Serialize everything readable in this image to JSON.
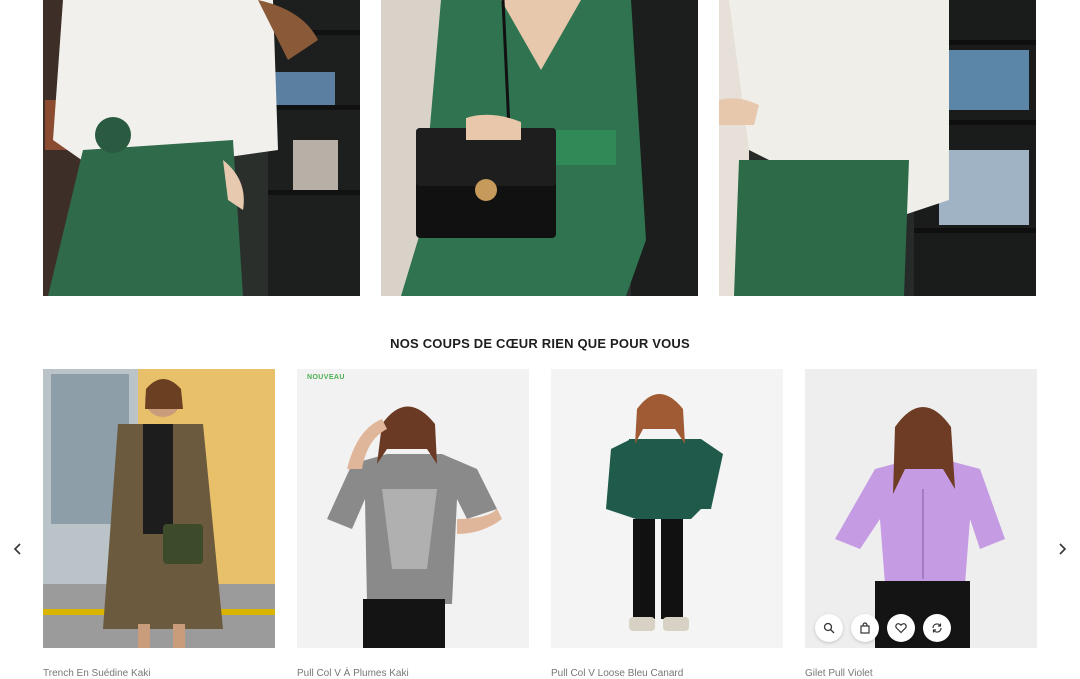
{
  "section": {
    "title": "NOS COUPS DE CŒUR RIEN QUE POUR VOUS"
  },
  "lookbook": [
    {
      "icon": "white-sweater-green-skirt-photo"
    },
    {
      "icon": "green-dress-black-bag-photo"
    },
    {
      "icon": "white-sweater-floral-skirt-photo"
    }
  ],
  "products": [
    {
      "name": "Trench En Suédine Kaki",
      "badge": "",
      "image": "khaki-trench-photo"
    },
    {
      "name": "Pull Col V À Plumes Kaki",
      "badge": "NOUVEAU",
      "image": "grey-tshirt-photo"
    },
    {
      "name": "Pull Col V Loose Bleu Canard",
      "badge": "",
      "image": "teal-sweater-photo"
    },
    {
      "name": "Gilet Pull Violet",
      "badge": "",
      "image": "lilac-cardigan-photo"
    }
  ],
  "actions": [
    "search-icon",
    "cart-icon",
    "heart-icon",
    "compare-icon"
  ],
  "colors": {
    "badge": "#4caf50",
    "heading": "#1e1e1e",
    "product_name": "#777777"
  }
}
